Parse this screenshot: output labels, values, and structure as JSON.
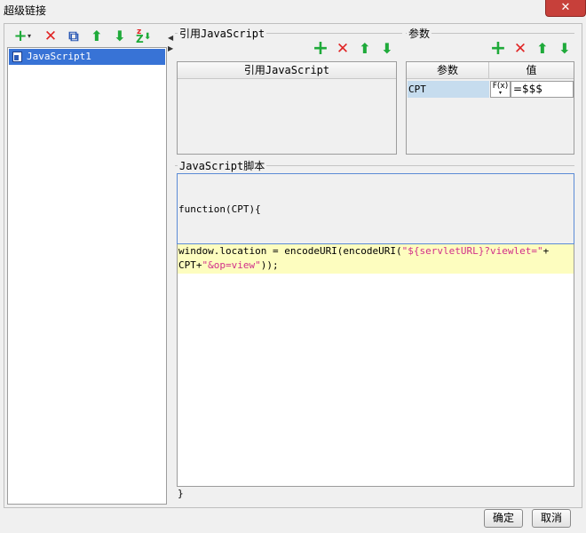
{
  "window": {
    "title": "超级链接",
    "close_glyph": "✕"
  },
  "left": {
    "toolbar": [
      {
        "name": "add-icon",
        "glyph": "+"
      },
      {
        "name": "delete-icon",
        "glyph": "✕"
      },
      {
        "name": "copy-icon",
        "glyph": "⧉"
      },
      {
        "name": "move-up-icon",
        "glyph": "⬆"
      },
      {
        "name": "move-down-icon",
        "glyph": "⬇"
      },
      {
        "name": "sort-icon",
        "glyph": "Z"
      }
    ],
    "tree_items": [
      {
        "label": "JavaScript1",
        "selected": true
      }
    ]
  },
  "imports": {
    "group_label": "引用JavaScript",
    "column_header": "引用JavaScript"
  },
  "params": {
    "group_label": "参数",
    "col_param": "参数",
    "col_value": "值",
    "rows": [
      {
        "param": "CPT",
        "fx": "F(x)",
        "value": "=$$$"
      }
    ]
  },
  "script": {
    "group_label": "JavaScript脚本",
    "header_line": "function(CPT){",
    "body_line1_a": "window.location = encodeURI(encodeURI(",
    "body_line1_str": "\"${servletURL}?viewlet=\"",
    "body_line1_b": "+",
    "body_line2_a": "CPT+",
    "body_line2_str": "\"&op=view\"",
    "body_line2_b": "));",
    "footer_line": "}"
  },
  "buttons": {
    "ok": "确定",
    "cancel": "取消"
  },
  "colors": {
    "selection": "#3873d6",
    "green": "#1faa3a",
    "red": "#e02424",
    "highlight": "#fdfdbf"
  }
}
